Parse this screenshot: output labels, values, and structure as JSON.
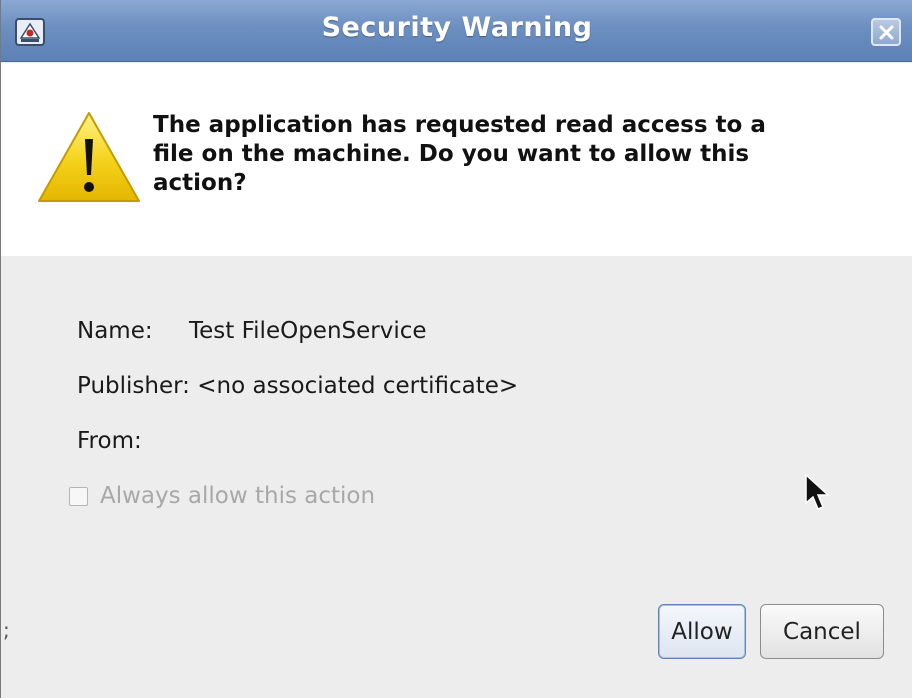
{
  "window": {
    "title": "Security Warning",
    "app_icon": "java-app-icon",
    "close_icon": "close-icon"
  },
  "header": {
    "icon": "warning-icon",
    "message": "The application has requested read access to a\nfile on the machine. Do you want to allow this\naction?"
  },
  "details": {
    "name_label": "Name:",
    "name_value": "Test FileOpenService",
    "publisher_label": "Publisher:",
    "publisher_value": "<no associated certificate>",
    "from_label": "From:",
    "from_value": ""
  },
  "always_allow": {
    "label": "Always allow this action",
    "checked": false,
    "enabled": false
  },
  "buttons": {
    "allow": "Allow",
    "cancel": "Cancel"
  },
  "edge_glyph": ";",
  "colors": {
    "titlebar": "#6c8fc0",
    "warning_yellow": "#f4d21a",
    "default_button_border": "#5f82b8"
  }
}
